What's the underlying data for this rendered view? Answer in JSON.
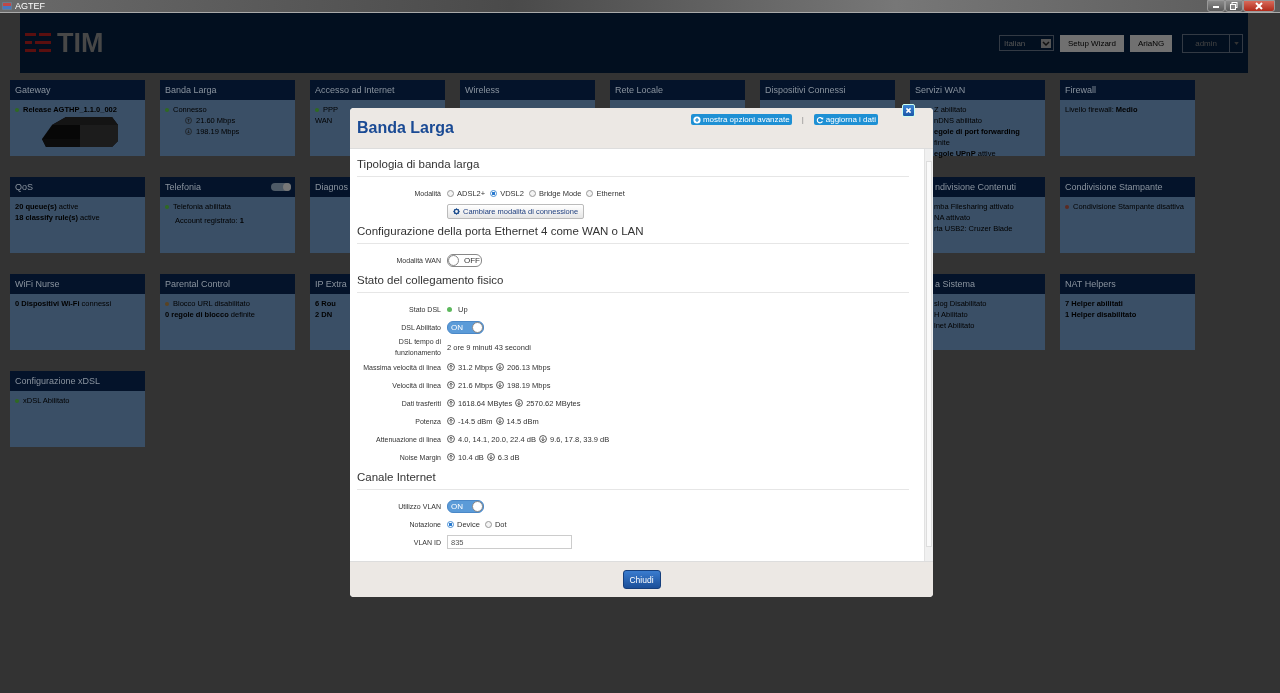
{
  "window": {
    "title": "AGTEF"
  },
  "header": {
    "logo": "TIM",
    "language": "Italian",
    "buttons": [
      "Setup Wizard",
      "AriaNG"
    ],
    "user": "admin"
  },
  "card_rows": [
    [
      {
        "title": "Gateway",
        "kind": "picture",
        "lines": [
          {
            "kind": "status-strong",
            "text": "Release AGTHP_1.1.0_002",
            "color": "#2f6a22"
          }
        ]
      },
      {
        "title": "Banda Larga",
        "kind": "plain",
        "lines": [
          {
            "kind": "status",
            "text": "Connesso",
            "color": "#2f6a22"
          },
          {
            "kind": "upload",
            "text": "21.60 Mbps"
          },
          {
            "kind": "download",
            "text": "198.19 Mbps"
          }
        ]
      },
      {
        "title": "Accesso ad Internet",
        "kind": "plain",
        "lines": [
          {
            "kind": "status",
            "text": "PPP",
            "color": "#2f6a22"
          },
          {
            "kind": "text",
            "text": "WAN"
          }
        ]
      },
      {
        "title": "Wireless",
        "kind": "plain"
      },
      {
        "title": "Rete Locale",
        "kind": "plain"
      },
      {
        "title": "Dispositivi Connessi",
        "kind": "plain"
      },
      {
        "title": "Servizi WAN",
        "kind": "plain",
        "lines": [
          {
            "kind": "text",
            "text": "Z abilitato"
          },
          {
            "kind": "text",
            "text": "nDNS abilitato"
          },
          {
            "kind": "strong",
            "text": "egole di port forwarding"
          },
          {
            "kind": "text",
            "text": "finite"
          },
          {
            "kind": "text",
            "text": "**egole UPnP** attive"
          }
        ]
      },
      {
        "title": "Firewall",
        "kind": "plain",
        "lines": [
          {
            "kind": "text",
            "text": "Livello firewall: **Medio**"
          }
        ]
      }
    ],
    [
      {
        "title": "QoS",
        "kind": "plain",
        "lines": [
          {
            "kind": "text",
            "text": "**20 queue(s)** active"
          },
          {
            "kind": "text",
            "text": "**18 classify rule(s)** active"
          }
        ]
      },
      {
        "title": "Telefonia",
        "kind": "toggle",
        "on": true,
        "lines": [
          {
            "kind": "status",
            "text": "Telefonia abilitata",
            "color": "#2f6a22"
          },
          {
            "kind": "text",
            "text": "Account registrato: **1**"
          }
        ]
      },
      {
        "title": "Diagnos",
        "kind": "plain"
      },
      {
        "title": "ndivisione Contenuti",
        "kind": "plain",
        "lines": [
          {
            "kind": "text",
            "text": "mba Filesharing attivato"
          },
          {
            "kind": "text",
            "text": "NA attivato"
          },
          {
            "kind": "text",
            "text": "rta USB2: Cruzer Blade"
          }
        ]
      },
      {
        "title": "Condivisione Stampante",
        "kind": "plain",
        "lines": [
          {
            "kind": "status",
            "text": "Condivisione Stampante disattiva",
            "color": "#5a2a22"
          }
        ]
      }
    ],
    [
      {
        "title": "WiFi Nurse",
        "kind": "plain",
        "lines": [
          {
            "kind": "text",
            "text": "**0 Dispositivi Wi-Fi** connessi"
          }
        ]
      },
      {
        "title": "Parental Control",
        "kind": "plain",
        "lines": [
          {
            "kind": "status",
            "text": "Blocco URL disabilitato",
            "color": "#5a4322"
          },
          {
            "kind": "text",
            "text": "**0 regole di blocco** definite"
          }
        ]
      },
      {
        "title": "IP Extra",
        "kind": "plain",
        "lines": [
          {
            "kind": "strong",
            "text": "6 Rou"
          },
          {
            "kind": "strong",
            "text": "2 DN"
          }
        ]
      },
      {
        "title": "a Sistema",
        "kind": "plain",
        "lines": [
          {
            "kind": "text",
            "text": "slog Disabilitato"
          },
          {
            "kind": "text",
            "text": "H Abilitato"
          },
          {
            "kind": "text",
            "text": "lnet Abilitato"
          }
        ]
      },
      {
        "title": "NAT Helpers",
        "kind": "plain",
        "lines": [
          {
            "kind": "strong",
            "text": "7 Helper abilitati"
          },
          {
            "kind": "strong",
            "text": "1 Helper disabilitato"
          }
        ]
      }
    ],
    [
      {
        "title": "Configurazione xDSL",
        "kind": "plain",
        "lines": [
          {
            "kind": "status",
            "text": "xDSL Abilitato",
            "color": "#2f6a22"
          }
        ]
      }
    ]
  ],
  "dialog": {
    "title": "Banda Larga",
    "actions": [
      {
        "kind": "expand",
        "label": "mostra opzioni avanzate"
      },
      {
        "kind": "refresh",
        "label": "aggiorna i dati"
      }
    ],
    "separator": "|",
    "button": "Chiudi",
    "sections": [
      {
        "title": "Tipologia di banda larga",
        "rows": [
          {
            "kind": "radio",
            "label": "Modalità",
            "options": [
              {
                "label": "ADSL2+",
                "selected": false
              },
              {
                "label": "VDSL2",
                "selected": true
              },
              {
                "label": "Bridge Mode",
                "selected": false
              },
              {
                "label": "Ethernet",
                "selected": false
              }
            ]
          },
          {
            "kind": "button",
            "text": "Cambiare modalità di connessione"
          }
        ]
      },
      {
        "title": "Configurazione della porta Ethernet 4 come WAN o LAN",
        "rows": [
          {
            "kind": "toggle",
            "label": "Modalità WAN",
            "on": false,
            "text": "OFF"
          }
        ]
      },
      {
        "title": "Stato del collegamento fisico",
        "rows": [
          {
            "kind": "status",
            "label": "Stato DSL",
            "value": "Up",
            "color": "#5cb85c"
          },
          {
            "kind": "toggle",
            "label": "DSL Abilitato",
            "on": true,
            "text": "ON"
          },
          {
            "kind": "text",
            "label": "DSL tempo di funzionamento",
            "value": "2 ore 9 minuti 43 secondi"
          },
          {
            "kind": "updown",
            "label": "Massima velocità di linea",
            "up": "31.2 Mbps",
            "down": "206.13 Mbps"
          },
          {
            "kind": "updown",
            "label": "Velocità di linea",
            "up": "21.6 Mbps",
            "down": "198.19 Mbps"
          },
          {
            "kind": "updown",
            "label": "Dati trasferiti",
            "up": "1618.64 MBytes",
            "down": "2570.62 MBytes"
          },
          {
            "kind": "updown",
            "label": "Potenza",
            "up": "-14.5 dBm",
            "down": "14.5 dBm"
          },
          {
            "kind": "updown",
            "label": "Attenuazione di linea",
            "up": "4.0, 14.1, 20.0, 22.4 dB",
            "down": "9.6, 17.8, 33.9 dB"
          },
          {
            "kind": "updown",
            "label": "Noise Margin",
            "up": "10.4 dB",
            "down": "6.3 dB"
          }
        ]
      },
      {
        "title": "Canale Internet",
        "rows": [
          {
            "kind": "toggle",
            "label": "Utilizzo VLAN",
            "on": true,
            "text": "ON"
          },
          {
            "kind": "radio",
            "label": "Notazione",
            "options": [
              {
                "label": "Device",
                "selected": true
              },
              {
                "label": "Dot",
                "selected": false
              }
            ]
          },
          {
            "kind": "field",
            "label": "VLAN ID",
            "value": "835"
          }
        ]
      }
    ]
  }
}
